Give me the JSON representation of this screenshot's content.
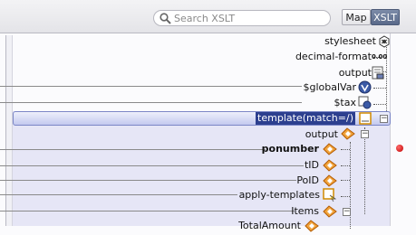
{
  "search": {
    "placeholder": "Search XSLT"
  },
  "tabs": [
    {
      "label": "Map",
      "active": false
    },
    {
      "label": "XSLT",
      "active": true
    }
  ],
  "tree": {
    "nodes": [
      {
        "label": "stylesheet",
        "icon": "stylesheet-icon"
      },
      {
        "label": "decimal-format",
        "icon": "decimal-format-icon",
        "icon_text": "0.00"
      },
      {
        "label": "output",
        "icon": "output-icon"
      },
      {
        "label": "$globalVar",
        "icon": "variable-icon"
      },
      {
        "label": "$tax",
        "icon": "variable-icon"
      },
      {
        "label": "template(match=/)",
        "icon": "template-icon",
        "selected": true
      },
      {
        "label": "output",
        "icon": "element-icon"
      },
      {
        "label": "ponumber",
        "icon": "element-icon",
        "bold": true
      },
      {
        "label": "tID",
        "icon": "element-icon"
      },
      {
        "label": "PoID",
        "icon": "element-icon"
      },
      {
        "label": "apply-templates",
        "icon": "apply-templates-icon"
      },
      {
        "label": "Items",
        "icon": "element-icon"
      },
      {
        "label": "TotalAmount",
        "icon": "element-icon"
      }
    ]
  },
  "colors": {
    "selection": "#2c3f8f",
    "element_icon": "#e07a12",
    "error_marker": "#d00000",
    "active_tab": "#5a6a8a"
  }
}
